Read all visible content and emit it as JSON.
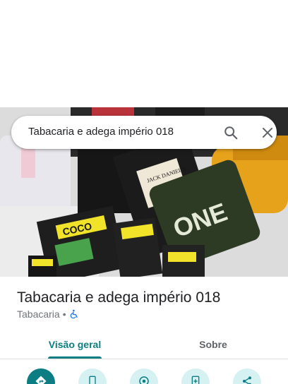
{
  "search": {
    "query": "Tabacaria e adega império 018"
  },
  "place": {
    "name": "Tabacaria e adega império 018",
    "category": "Tabacaria",
    "separator": "•"
  },
  "tabs": [
    {
      "label": "Visão geral",
      "active": true
    },
    {
      "label": "Sobre",
      "active": false
    }
  ],
  "photo": {
    "bottle_label_text": "JACK DANIEL'S",
    "can_brand": "ONE",
    "box_brand": "COCO",
    "box_sub": "QUADRADO"
  },
  "icons": [
    "search-icon",
    "close-icon",
    "accessibility-icon",
    "directions-icon",
    "phone-icon",
    "nearby-icon",
    "save-icon",
    "share-icon"
  ],
  "colors": {
    "accent": "#0b7d83",
    "accent_light": "#d5f1f2",
    "text": "#202124",
    "muted": "#70757a"
  }
}
